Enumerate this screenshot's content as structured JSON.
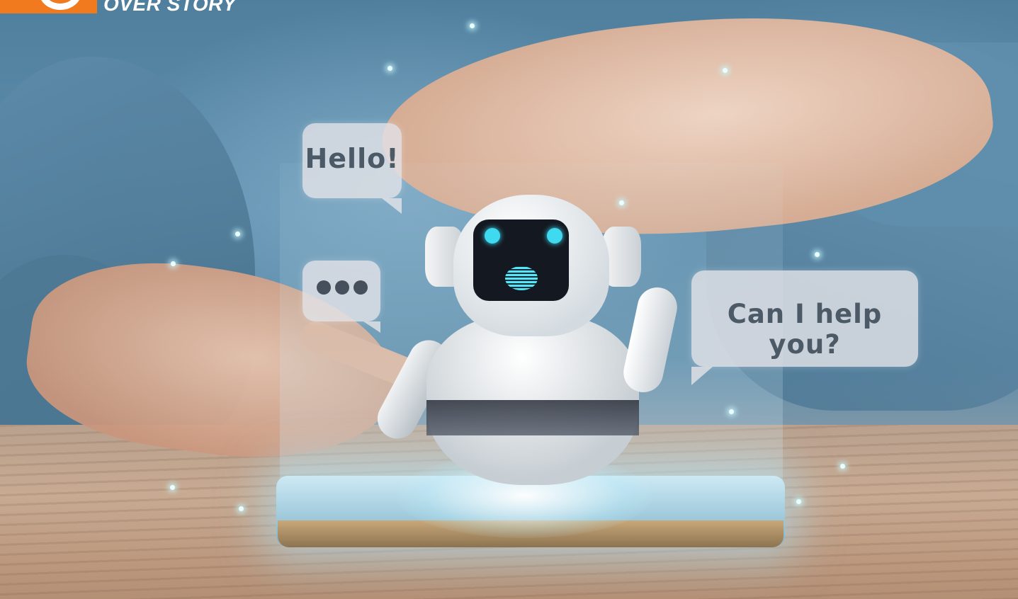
{
  "logo": {
    "text": "OVER STORY",
    "brand_color": "#f07a1d",
    "icon": "logo-ring-icon"
  },
  "bubbles": {
    "greeting": "Hello!",
    "typing_icon": "ellipsis-icon",
    "offer": "Can I help you?"
  },
  "colors": {
    "bubble_text": "#4b5a66",
    "hologram_glow": "#39e5ff"
  }
}
